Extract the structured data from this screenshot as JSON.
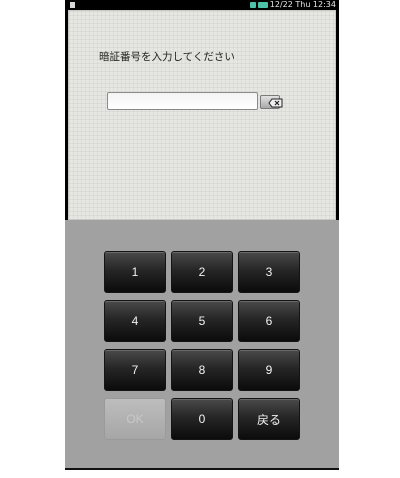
{
  "status_bar": {
    "date_time": "12/22 Thu  12:34",
    "icons": [
      "wifi-icon",
      "battery-icon"
    ]
  },
  "pin_panel": {
    "prompt": "暗証番号を入力してください",
    "input_value": "",
    "backspace_icon": "backspace-icon"
  },
  "keypad": {
    "keys": [
      "1",
      "2",
      "3",
      "4",
      "5",
      "6",
      "7",
      "8",
      "9",
      "OK",
      "0",
      "戻る"
    ],
    "ok_enabled": false
  },
  "colors": {
    "panel_bg": "#e6e6e2",
    "keypad_bg": "#a2a1a1",
    "key_face": "#262626",
    "status_icon": "#4cc3a8"
  }
}
